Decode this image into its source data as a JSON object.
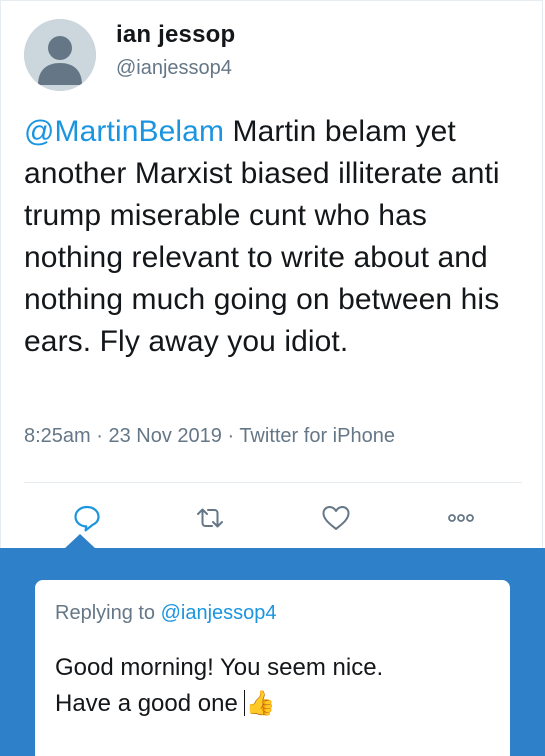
{
  "tweet": {
    "author": {
      "name": "ian jessop",
      "handle": "@ianjessop4"
    },
    "mention": "@MartinBelam",
    "body": " Martin belam yet another Marxist biased illiterate anti trump miserable cunt who has nothing relevant to write about and nothing much going on between his ears. Fly away you idiot.",
    "meta": "8:25am · 23 Nov 2019 · Twitter for iPhone",
    "actions": {
      "reply_icon": "speech-bubble-icon",
      "retweet_icon": "retweet-arrows-icon",
      "like_icon": "heart-icon",
      "more_icon": "ellipsis-icon"
    }
  },
  "reply": {
    "replying_prefix": "Replying to",
    "replying_handle": "@ianjessop4",
    "line1": "Good morning! You seem nice.",
    "line2": "Have a good one",
    "emoji": "👍"
  },
  "colors": {
    "accent": "#1b95e0",
    "reply_background": "#2e81c8",
    "muted_text": "#657786",
    "primary_text": "#14171a"
  }
}
